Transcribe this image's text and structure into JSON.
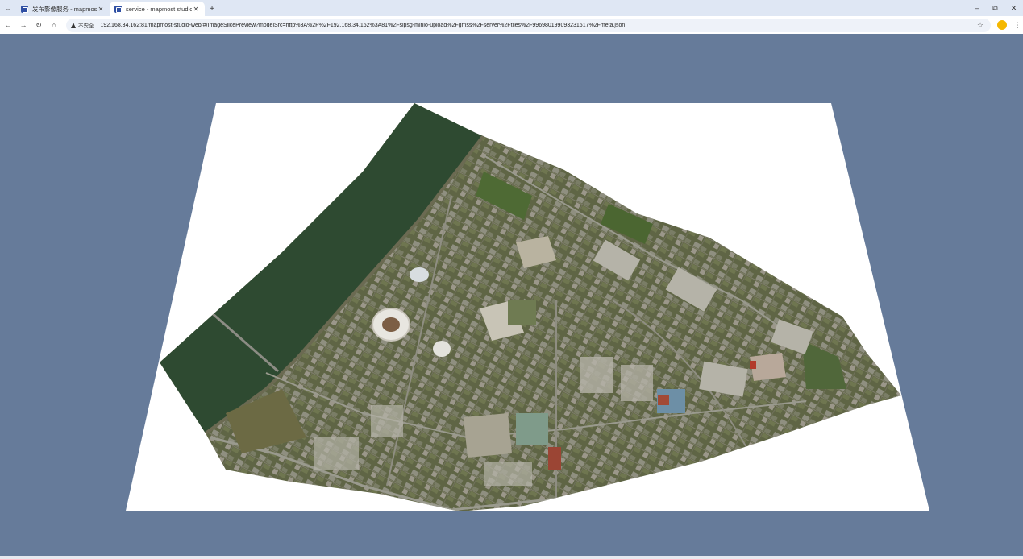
{
  "browser": {
    "tabs": [
      {
        "title": "发布影像服务 - mapmost stu",
        "active": false
      },
      {
        "title": "service - mapmost studio",
        "active": true
      }
    ],
    "new_tab_label": "+",
    "tab_menu_glyph": "⌄",
    "close_glyph": "✕",
    "window_controls": {
      "minimize": "–",
      "restore": "⧉",
      "close": "✕"
    },
    "nav": {
      "back": "←",
      "forward": "→",
      "reload": "↻",
      "home": "⌂"
    },
    "security_label": "不安全",
    "url": "192.168.34.162:81/mapmost-studio-web/#/ImageSlicePreview?modelSrc=http%3A%2F%2F192.168.34.162%3A81%2Fsipsg-minio-upload%2Fgmss%2Fserver%2Ftiles%2F996980199093231617%2Fmeta.json",
    "bookmark_glyph": "☆",
    "menu_glyph": "⋮"
  },
  "viewer": {
    "background_color": "#667b9a",
    "ground_color": "#ffffff",
    "water_color": "#2f4a32",
    "land_color": "#58603f"
  }
}
